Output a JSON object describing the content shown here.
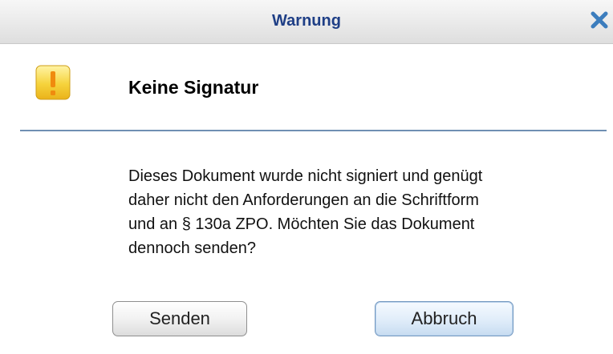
{
  "window": {
    "title": "Warnung",
    "close_icon": "close-icon"
  },
  "header": {
    "icon": "warning-icon",
    "heading": "Keine Signatur"
  },
  "message": {
    "text": "Dieses Dokument wurde nicht signiert und genügt\ndaher nicht den Anforderungen an die Schriftform\nund an § 130a ZPO. Möchten Sie das Dokument\ndennoch senden?"
  },
  "buttons": {
    "send_label": "Senden",
    "cancel_label": "Abbruch"
  },
  "colors": {
    "title_text": "#1f3f86",
    "close_icon": "#3c7dbd",
    "divider": "#6f8fb3",
    "warning_icon": "#f2c21b"
  }
}
